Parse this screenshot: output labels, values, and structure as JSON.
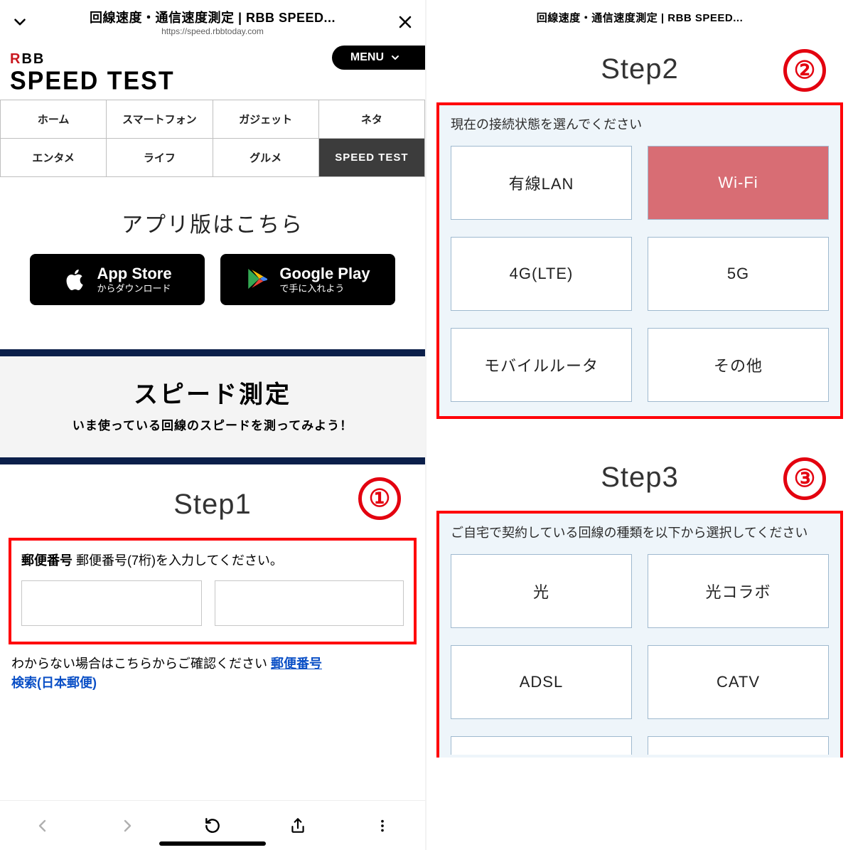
{
  "left": {
    "topbar": {
      "title": "回線速度・通信速度測定 | RBB SPEED...",
      "url": "https://speed.rbbtoday.com"
    },
    "logo": {
      "line1_prefix": "R",
      "line1_rest": "BB",
      "line2": "SPEED TEST"
    },
    "menu_label": "MENU",
    "nav": [
      "ホーム",
      "スマートフォン",
      "ガジェット",
      "ネタ",
      "エンタメ",
      "ライフ",
      "グルメ",
      "SPEED TEST"
    ],
    "nav_active_index": 7,
    "app_heading": "アプリ版はこちら",
    "appstore": {
      "l1": "App Store",
      "l2": "からダウンロード"
    },
    "googleplay": {
      "l1": "Google Play",
      "l2": "で手に入れよう"
    },
    "speed_title": "スピード測定",
    "speed_sub": "いま使っている回線のスピードを測ってみよう！",
    "step1_label": "Step1",
    "badge1": "①",
    "zip_label_strong": "郵便番号",
    "zip_label_rest": " 郵便番号(7桁)を入力してください。",
    "help_pre": "わからない場合はこちらからご確認ください ",
    "help_link": "郵便番号検索(日本郵便)",
    "help_link_visible_top": "郵便番号",
    "help_link_visible_bottom": "検索(日本郵便)"
  },
  "right": {
    "mini_title": "回線速度・通信速度測定 | RBB SPEED...",
    "step2_label": "Step2",
    "badge2": "②",
    "step2_prompt": "現在の接続状態を選んでください",
    "step2_options": [
      "有線LAN",
      "Wi-Fi",
      "4G(LTE)",
      "5G",
      "モバイルルータ",
      "その他"
    ],
    "step2_selected_index": 1,
    "step3_label": "Step3",
    "badge3": "③",
    "step3_prompt": "ご自宅で契約している回線の種類を以下から選択してください",
    "step3_options": [
      "光",
      "光コラボ",
      "ADSL",
      "CATV"
    ]
  }
}
